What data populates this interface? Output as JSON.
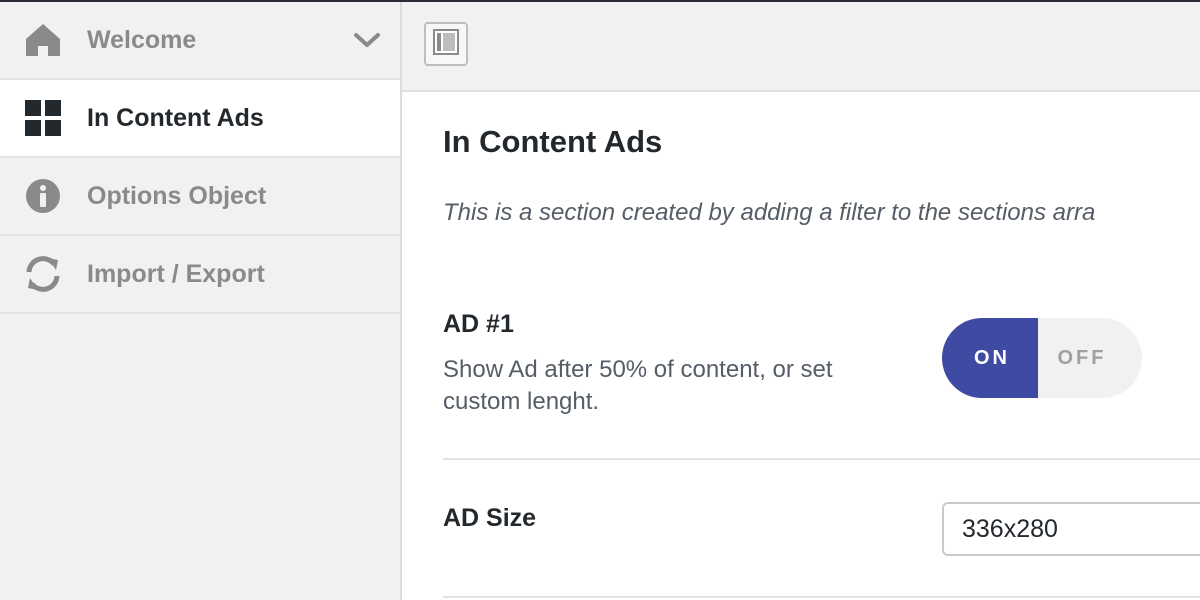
{
  "sidebar": {
    "items": [
      {
        "label": "Welcome",
        "icon": "home-icon"
      },
      {
        "label": "In Content Ads",
        "icon": "grid-icon"
      },
      {
        "label": "Options Object",
        "icon": "info-icon"
      },
      {
        "label": "Import / Export",
        "icon": "refresh-icon"
      }
    ]
  },
  "main": {
    "title": "In Content Ads",
    "description": "This is a section created by adding a filter to the sections arra",
    "fields": {
      "ad1": {
        "label": "AD #1",
        "description": "Show Ad after 50% of content, or set custom lenght.",
        "toggle_on": "ON",
        "toggle_off": "OFF",
        "state": "on"
      },
      "ad_size": {
        "label": "AD Size",
        "value": "336x280"
      }
    }
  },
  "colors": {
    "accent": "#3f4ba3",
    "sidebar_bg": "#f1f1f1",
    "text_dark": "#23282d",
    "text_muted": "#8a8a8a"
  }
}
